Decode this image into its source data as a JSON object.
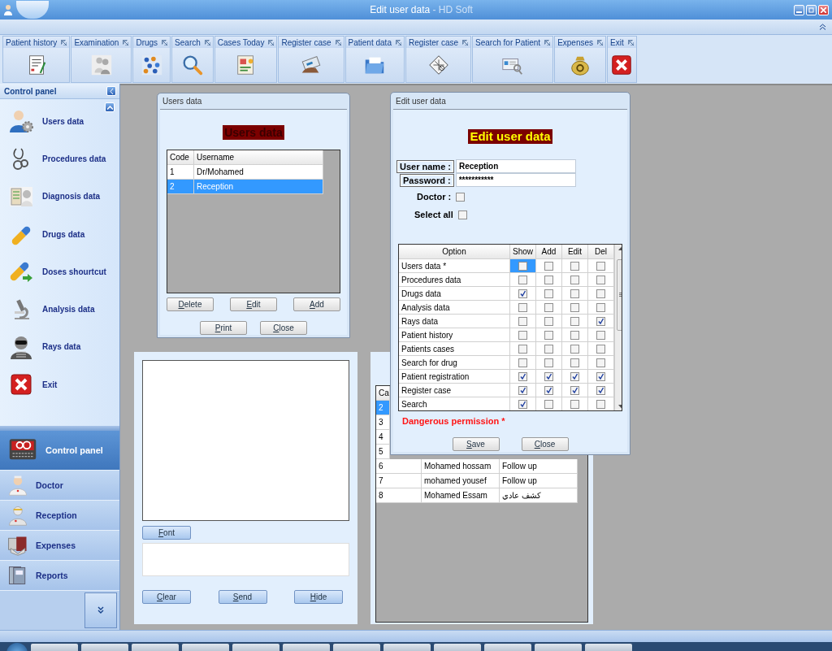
{
  "window": {
    "title": "Edit user data",
    "app_name": "- HD Soft"
  },
  "toolbar": [
    {
      "label": "Patient history"
    },
    {
      "label": "Examination"
    },
    {
      "label": "Drugs"
    },
    {
      "label": "Search"
    },
    {
      "label": "Cases Today"
    },
    {
      "label": "Register case"
    },
    {
      "label": "Patient  data"
    },
    {
      "label": "Register case"
    },
    {
      "label": "Search for  Patient"
    },
    {
      "label": "Expenses"
    },
    {
      "label": "Exit"
    }
  ],
  "sidebar": {
    "title": "Control panel",
    "items": [
      {
        "label": "Users data"
      },
      {
        "label": "Procedures data"
      },
      {
        "label": "Diagnosis data"
      },
      {
        "label": "Drugs data"
      },
      {
        "label": "Doses shourtcut"
      },
      {
        "label": "Analysis data"
      },
      {
        "label": "Rays data"
      },
      {
        "label": "Exit"
      }
    ]
  },
  "navigation": [
    {
      "label": "Control panel",
      "selected": true
    },
    {
      "label": "Doctor",
      "selected": false
    },
    {
      "label": "Reception",
      "selected": false
    },
    {
      "label": "Expenses",
      "selected": false
    },
    {
      "label": "Reports",
      "selected": false
    }
  ],
  "users_window": {
    "title": "Users data",
    "heading": "Users data",
    "columns": [
      "Code",
      "Username"
    ],
    "rows": [
      {
        "code": "1",
        "username": "Dr/Mohamed",
        "selected": false
      },
      {
        "code": "2",
        "username": "Reception",
        "selected": true
      }
    ],
    "buttons": [
      "Delete",
      "Edit",
      "Add",
      "Print",
      "Close"
    ]
  },
  "chat_panel": {
    "buttons": [
      "Font",
      "Clear",
      "Send",
      "Hide"
    ]
  },
  "cases_window": {
    "columns": [
      "Ca"
    ],
    "rows": [
      {
        "code": "2",
        "selected": true
      },
      {
        "code": "3",
        "selected": false
      },
      {
        "code": "4",
        "selected": false
      },
      {
        "code": "5",
        "selected": false
      },
      {
        "code": "6",
        "name": "Mohamed hossam",
        "type": "Follow up",
        "selected": false
      },
      {
        "code": "7",
        "name": "mohamed yousef",
        "type": "Follow up",
        "selected": false
      },
      {
        "code": "8",
        "name": "Mohamed Essam",
        "type": "كشف عادي",
        "selected": false
      }
    ]
  },
  "edit_window": {
    "title": "Edit user data",
    "heading": "Edit user data",
    "user_name_label": "User name :",
    "user_name": "Reception",
    "password_label": "Password :",
    "password": "***********",
    "doctor_label": "Doctor :",
    "doctor": false,
    "select_all_label": "Select all",
    "select_all": false,
    "columns": [
      "Option",
      "Show",
      "Add",
      "Edit",
      "Del"
    ],
    "permissions": [
      {
        "option": "Users data *",
        "current": true,
        "show": false,
        "add": false,
        "edit": false,
        "del": false
      },
      {
        "option": "Procedures data",
        "current": false,
        "show": false,
        "add": false,
        "edit": false,
        "del": false
      },
      {
        "option": "Drugs data",
        "current": false,
        "show": true,
        "add": false,
        "edit": false,
        "del": false
      },
      {
        "option": "Analysis data",
        "current": false,
        "show": false,
        "add": false,
        "edit": false,
        "del": false
      },
      {
        "option": "Rays data",
        "current": false,
        "show": false,
        "add": false,
        "edit": false,
        "del": true
      },
      {
        "option": "Patient history",
        "current": false,
        "show": false,
        "add": false,
        "edit": false,
        "del": false
      },
      {
        "option": "Patients cases",
        "current": false,
        "show": false,
        "add": false,
        "edit": false,
        "del": false
      },
      {
        "option": "Search for drug",
        "current": false,
        "show": false,
        "add": false,
        "edit": false,
        "del": false
      },
      {
        "option": "Patient registration",
        "current": false,
        "show": true,
        "add": true,
        "edit": true,
        "del": true
      },
      {
        "option": "Register case",
        "current": false,
        "show": true,
        "add": true,
        "edit": true,
        "del": true
      },
      {
        "option": "Search",
        "current": false,
        "show": true,
        "add": false,
        "edit": false,
        "del": false
      }
    ],
    "warning": "Dangerous permission *",
    "buttons": [
      "Save",
      "Close"
    ]
  }
}
